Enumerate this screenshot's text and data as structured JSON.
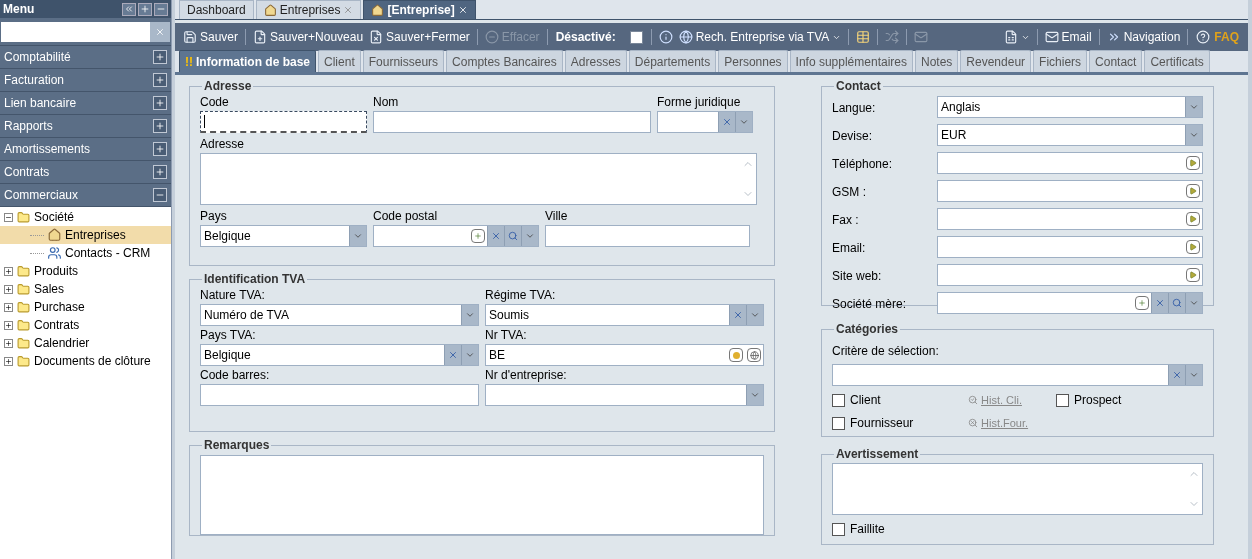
{
  "sidebar": {
    "title": "Menu",
    "sections": [
      {
        "label": "Comptabilité",
        "expanded": false
      },
      {
        "label": "Facturation",
        "expanded": false
      },
      {
        "label": "Lien bancaire",
        "expanded": false
      },
      {
        "label": "Rapports",
        "expanded": false
      },
      {
        "label": "Amortissements",
        "expanded": false
      },
      {
        "label": "Contrats",
        "expanded": false
      },
      {
        "label": "Commerciaux",
        "expanded": true
      }
    ],
    "tree": [
      {
        "label": "Société",
        "kind": "folder",
        "expanded": true,
        "selected": false,
        "children": [
          {
            "label": "Entreprises",
            "kind": "company",
            "selected": true
          },
          {
            "label": "Contacts - CRM",
            "kind": "contact",
            "selected": false
          }
        ]
      },
      {
        "label": "Produits",
        "kind": "folder",
        "expanded": false,
        "selected": false
      },
      {
        "label": "Sales",
        "kind": "folder",
        "expanded": false,
        "selected": false
      },
      {
        "label": "Purchase",
        "kind": "folder",
        "expanded": false,
        "selected": false
      },
      {
        "label": "Contrats",
        "kind": "folder",
        "expanded": false,
        "selected": false
      },
      {
        "label": "Calendrier",
        "kind": "folder",
        "expanded": false,
        "selected": false
      },
      {
        "label": "Documents de clôture",
        "kind": "folder",
        "expanded": false,
        "selected": false
      }
    ]
  },
  "doc_tabs": [
    {
      "label": "Dashboard",
      "kind": "plain",
      "closable": false,
      "selected": false
    },
    {
      "label": "Entreprises",
      "kind": "home",
      "closable": true,
      "selected": false
    },
    {
      "label": "[Entreprise]",
      "kind": "home",
      "closable": true,
      "selected": true
    }
  ],
  "toolbar": {
    "left": [
      {
        "kind": "button",
        "label": "Sauver",
        "disabled": false
      },
      {
        "kind": "separator"
      },
      {
        "kind": "button",
        "label": "Sauver+Nouveau",
        "disabled": false
      },
      {
        "kind": "button",
        "label": "Sauver+Fermer",
        "disabled": false
      },
      {
        "kind": "separator"
      },
      {
        "kind": "button",
        "label": "Effacer",
        "disabled": true
      },
      {
        "kind": "separator"
      },
      {
        "kind": "checkbox",
        "label": "Désactivé:",
        "checked": false
      },
      {
        "kind": "separator"
      },
      {
        "kind": "button",
        "disabled": false
      },
      {
        "kind": "menu",
        "label": "Rech. Entreprise via TVA",
        "disabled": false
      },
      {
        "kind": "separator"
      },
      {
        "kind": "button",
        "disabled": false
      },
      {
        "kind": "separator"
      },
      {
        "kind": "button",
        "disabled": true
      },
      {
        "kind": "separator"
      },
      {
        "kind": "button",
        "disabled": true
      }
    ],
    "right": [
      {
        "kind": "menu",
        "disabled": false
      },
      {
        "kind": "separator"
      },
      {
        "kind": "button",
        "label": "Email",
        "disabled": false
      },
      {
        "kind": "separator"
      },
      {
        "kind": "button",
        "label": "Navigation",
        "disabled": false
      },
      {
        "kind": "separator"
      },
      {
        "kind": "link",
        "label": "FAQ",
        "disabled": false
      }
    ]
  },
  "subtabs": [
    {
      "label": "Information de base",
      "alert": "!!",
      "selected": true
    },
    {
      "label": "Client",
      "selected": false
    },
    {
      "label": "Fournisseurs",
      "selected": false
    },
    {
      "label": "Comptes Bancaires",
      "selected": false
    },
    {
      "label": "Adresses",
      "selected": false
    },
    {
      "label": "Départements",
      "selected": false
    },
    {
      "label": "Personnes",
      "selected": false
    },
    {
      "label": "Info supplémentaires",
      "selected": false
    },
    {
      "label": "Notes",
      "selected": false
    },
    {
      "label": "Revendeur",
      "selected": false
    },
    {
      "label": "Fichiers",
      "selected": false
    },
    {
      "label": "Contact",
      "selected": false
    },
    {
      "label": "Certificats",
      "selected": false
    }
  ],
  "address": {
    "title": "Adresse",
    "fields": [
      {
        "label": "Code",
        "kind": "text",
        "focused": true
      },
      {
        "label": "Nom",
        "kind": "text"
      },
      {
        "label": "Forme juridique",
        "kind": "combo"
      },
      {
        "label": "Adresse",
        "kind": "textarea"
      },
      {
        "label": "Pays",
        "kind": "combo",
        "value": "Belgique"
      },
      {
        "label": "Code postal",
        "kind": "combo"
      },
      {
        "label": "Ville",
        "kind": "text"
      }
    ]
  },
  "vat": {
    "title": "Identification TVA",
    "fields": [
      {
        "label": "Nature TVA:",
        "kind": "combo",
        "value": "Numéro de TVA"
      },
      {
        "label": "Régime TVA:",
        "kind": "combo",
        "value": "Soumis"
      },
      {
        "label": "Pays TVA:",
        "kind": "combo",
        "value": "Belgique"
      },
      {
        "label": "Nr TVA:",
        "kind": "text",
        "value": "BE"
      },
      {
        "label": "Code barres:",
        "kind": "text"
      },
      {
        "label": "Nr d'entreprise:",
        "kind": "combo"
      }
    ]
  },
  "remarks": {
    "title": "Remarques"
  },
  "contact": {
    "title": "Contact",
    "fields": [
      {
        "label": "Langue:",
        "kind": "combo",
        "value": "Anglais"
      },
      {
        "label": "Devise:",
        "kind": "combo",
        "value": "EUR"
      },
      {
        "label": "Téléphone:",
        "kind": "text"
      },
      {
        "label": "GSM :",
        "kind": "text"
      },
      {
        "label": "Fax :",
        "kind": "text"
      },
      {
        "label": "Email:",
        "kind": "text"
      },
      {
        "label": "Site web:",
        "kind": "text"
      },
      {
        "label": "Société mère:",
        "kind": "combo"
      }
    ]
  },
  "categories": {
    "title": "Catégories",
    "criteria_label": "Critère de sélection:",
    "checks": [
      {
        "label": "Client",
        "checked": false
      },
      {
        "label": "Fournisseur",
        "checked": false
      }
    ],
    "links": [
      {
        "label": "Hist. Cli."
      },
      {
        "label": "Hist.Four."
      }
    ],
    "prospect": {
      "label": "Prospect",
      "checked": false
    }
  },
  "warning": {
    "title": "Avertissement",
    "bankrupt": {
      "label": "Faillite",
      "checked": false
    }
  }
}
